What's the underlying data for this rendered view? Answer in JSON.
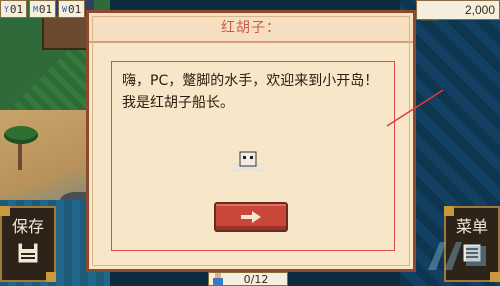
{
  "hud": {
    "counters": [
      {
        "key": "Y",
        "value": "01"
      },
      {
        "key": "M",
        "value": "01"
      },
      {
        "key": "W",
        "value": "01"
      }
    ],
    "gold": "2,000",
    "crew_progress": "0/12"
  },
  "dialog": {
    "speaker": "红胡子：",
    "message": "嗨，PC，蹩脚的水手，欢迎来到小开岛！我是红胡子船长。",
    "next_icon": "right-arrow-icon"
  },
  "buttons": {
    "save_label": "保存",
    "menu_label": "菜单"
  },
  "icons": [
    "coin-stack-icon",
    "skull-crossbones-icon",
    "floppy-disk-icon",
    "book-icon",
    "crew-member-icon"
  ],
  "colors": {
    "dialog_title": "#c75b4a",
    "dialog_border": "#8b4a2e",
    "next_button": "#c8463a",
    "parchment": "#f7e7c8"
  }
}
